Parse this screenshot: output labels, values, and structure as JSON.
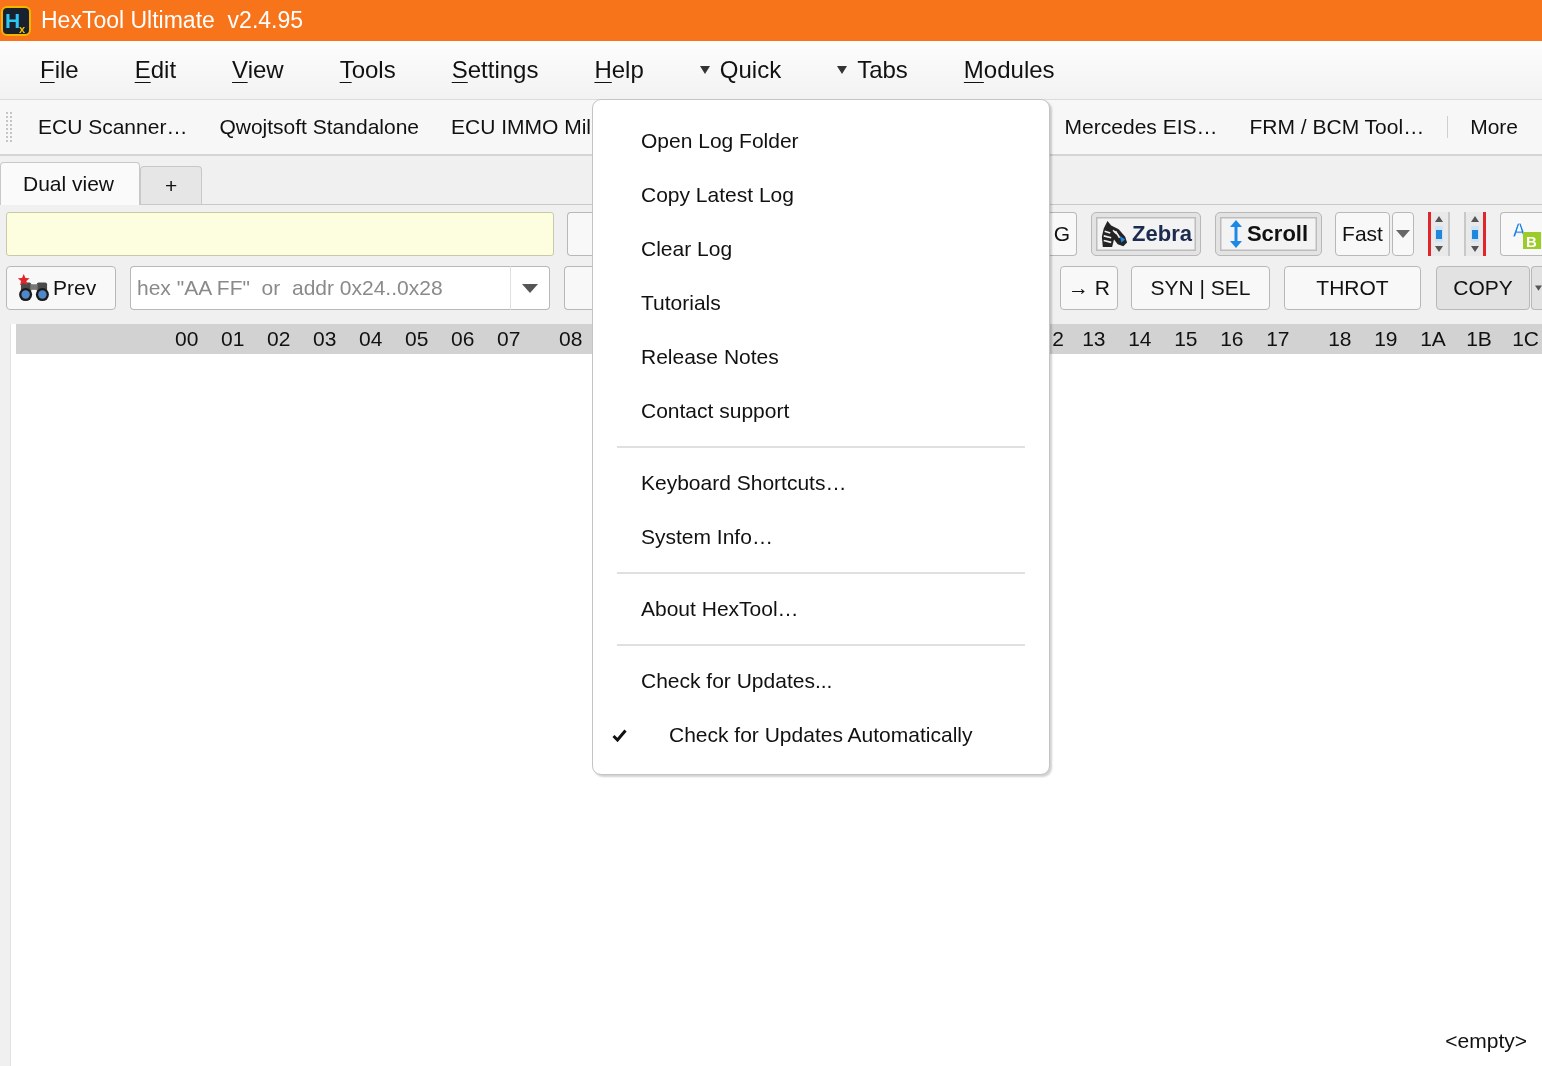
{
  "window": {
    "title": "HexTool Ultimate  v2.4.95",
    "logo": {
      "letter": "H",
      "subscript": "x"
    }
  },
  "menu_bar": {
    "items": [
      {
        "label": "File",
        "kind": "menu"
      },
      {
        "label": "Edit",
        "kind": "menu"
      },
      {
        "label": "View",
        "kind": "menu"
      },
      {
        "label": "Tools",
        "kind": "menu"
      },
      {
        "label": "Settings",
        "kind": "menu"
      },
      {
        "label": "Help",
        "kind": "menu"
      },
      {
        "label": "Quick",
        "kind": "dropdown"
      },
      {
        "label": "Tabs",
        "kind": "dropdown"
      },
      {
        "label": "Modules",
        "kind": "menu"
      }
    ]
  },
  "shortcut_toolbar": {
    "left_items": [
      "ECU Scanner…",
      "Qwojtsoft Standalone",
      "ECU IMMO Mil"
    ],
    "right_items": [
      "Mercedes EIS…",
      "FRM / BCM Tool…"
    ],
    "overflow_button": "More"
  },
  "tabs": [
    {
      "label": "Dual view",
      "selected": true
    },
    {
      "label": "+",
      "selected": false
    }
  ],
  "filter_row": {
    "cut_button": {
      "label": "G"
    },
    "zebra_toggle": {
      "label": "Zebra",
      "checked": true
    },
    "scroll_toggle": {
      "label": "Scroll",
      "checked": true
    },
    "speed_button": {
      "label": "Fast"
    },
    "ab_icon": {
      "letter_a": "A",
      "letter_b": "B"
    }
  },
  "search_row": {
    "prev_button": {
      "label": "Prev"
    },
    "search_combo": {
      "placeholder": "hex \"AA FF\"  or  addr 0x24..0x28"
    },
    "buttons": [
      {
        "label": "→ R"
      },
      {
        "label": "SYN | SEL"
      },
      {
        "label": "THROT"
      }
    ],
    "copy_button": {
      "label": "COPY"
    }
  },
  "hex_view": {
    "left_blocks": [
      {
        "columns": [
          "00",
          "01",
          "02",
          "03",
          "04",
          "05",
          "06",
          "07"
        ]
      },
      {
        "columns": [
          "08"
        ]
      }
    ],
    "right_blocks": [
      {
        "columns": [
          "2",
          "13",
          "14",
          "15",
          "16",
          "17"
        ]
      },
      {
        "columns": [
          "18",
          "19",
          "1A",
          "1B",
          "1C"
        ]
      }
    ],
    "status": "<empty>"
  },
  "help_menu": {
    "groups": [
      {
        "items": [
          {
            "label": "Open Log Folder",
            "kind": "action"
          },
          {
            "label": "Copy Latest Log",
            "kind": "action"
          },
          {
            "label": "Clear Log",
            "kind": "action"
          },
          {
            "label": "Tutorials",
            "kind": "action"
          },
          {
            "label": "Release Notes",
            "kind": "action"
          },
          {
            "label": "Contact support",
            "kind": "action"
          }
        ]
      },
      {
        "items": [
          {
            "label": "Keyboard Shortcuts…",
            "kind": "action"
          },
          {
            "label": "System Info…",
            "kind": "action"
          }
        ]
      },
      {
        "items": [
          {
            "label": "About HexTool…",
            "kind": "action"
          }
        ]
      },
      {
        "items": [
          {
            "label": "Check for Updates...",
            "kind": "action"
          },
          {
            "label": "Check for Updates Automatically",
            "kind": "checkbox",
            "checked": true
          }
        ]
      }
    ]
  }
}
